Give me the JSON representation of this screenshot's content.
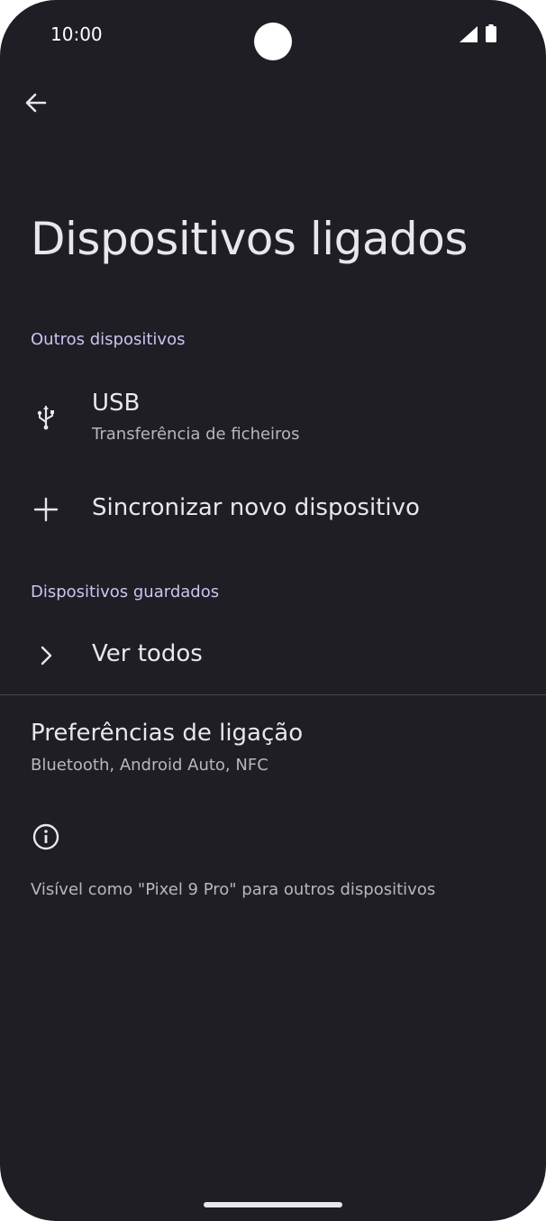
{
  "status_bar": {
    "time": "10:00"
  },
  "header": {
    "title": "Dispositivos ligados"
  },
  "sections": {
    "other_devices": {
      "header": "Outros dispositivos",
      "usb": {
        "title": "USB",
        "subtitle": "Transferência de ficheiros"
      },
      "pair_new": {
        "title": "Sincronizar novo dispositivo"
      }
    },
    "saved_devices": {
      "header": "Dispositivos guardados",
      "see_all": {
        "title": "Ver todos"
      }
    }
  },
  "connection_prefs": {
    "title": "Preferências de ligação",
    "subtitle": "Bluetooth, Android Auto, NFC"
  },
  "footer_info": {
    "text": "Visível como \"Pixel 9 Pro\" para outros dispositivos"
  },
  "colors": {
    "background": "#1e1e24",
    "accent": "#cdc3f0",
    "text": "#e9e6ee",
    "subtext": "#b9b6be"
  },
  "icons": [
    "back-arrow-icon",
    "usb-icon",
    "plus-icon",
    "chevron-right-icon",
    "info-icon",
    "signal-icon",
    "battery-icon"
  ]
}
